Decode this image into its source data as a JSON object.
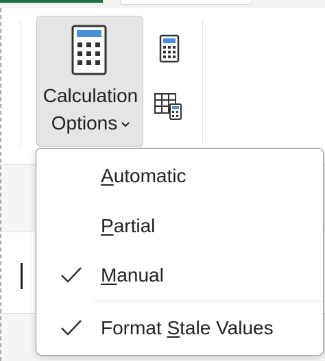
{
  "ribbon": {
    "calculation_options": {
      "label_line1": "Calculation",
      "label_line2": "Options",
      "icon": "calculator-icon",
      "dropdown_icon": "chevron-down-icon"
    },
    "calculate_now": {
      "icon": "calculator-small-icon"
    },
    "calculate_sheet": {
      "icon": "calculate-sheet-icon"
    }
  },
  "menu": {
    "items": [
      {
        "mnemonic": "A",
        "rest": "utomatic",
        "checked": false
      },
      {
        "mnemonic": "P",
        "rest": "artial",
        "checked": false
      },
      {
        "mnemonic": "M",
        "rest": "anual",
        "checked": true
      },
      {
        "before": "Format ",
        "mnemonic": "S",
        "rest": "tale Values",
        "checked": true
      }
    ]
  },
  "colors": {
    "accent_green": "#1e7145",
    "calculator_blue": "#4a90d9",
    "icon_dark": "#333333"
  }
}
